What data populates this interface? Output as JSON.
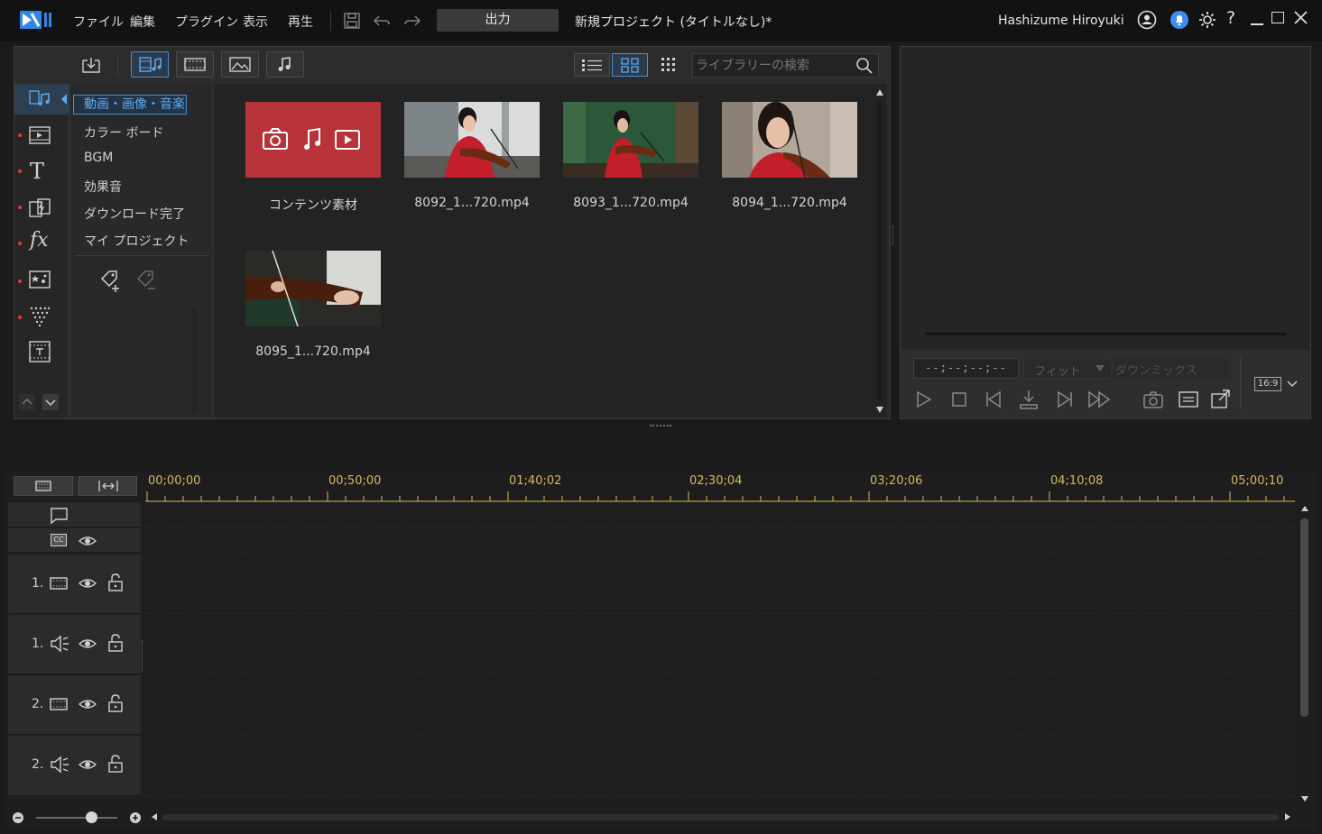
{
  "menu": [
    "ファイル",
    "編集",
    "プラグイン",
    "表示",
    "再生"
  ],
  "output_button": "出力",
  "project_title": "新規プロジェクト (タイトルなし)*",
  "user_name": "Hashizume Hiroyuki",
  "library": {
    "search_placeholder": "ライブラリーの検索",
    "categories": [
      "動画・画像・音楽",
      "カラー ボード",
      "BGM",
      "効果音",
      "ダウンロード完了",
      "マイ プロジェクト"
    ],
    "items": [
      {
        "label": "コンテンツ素材",
        "type": "content-pack"
      },
      {
        "label": "8092_1...720.mp4",
        "type": "video"
      },
      {
        "label": "8093_1...720.mp4",
        "type": "video"
      },
      {
        "label": "8094_1...720.mp4",
        "type": "video"
      },
      {
        "label": "8095_1...720.mp4",
        "type": "video"
      }
    ]
  },
  "preview": {
    "timecode": "--;--;--;--",
    "fit": "フィット",
    "dropdown_label": "ダウンミックス",
    "aspect": "16:9"
  },
  "timeline": {
    "ticks": [
      "00;00;00",
      "00;50;00",
      "01;40;02",
      "02;30;04",
      "03;20;06",
      "04;10;08",
      "05;00;10"
    ],
    "tracks": [
      {
        "num": "1.",
        "kind": "video"
      },
      {
        "num": "1.",
        "kind": "audio"
      },
      {
        "num": "2.",
        "kind": "video"
      },
      {
        "num": "2.",
        "kind": "audio"
      }
    ]
  },
  "colors": {
    "accent": "#4a8bd6",
    "ruler": "#d8b85a",
    "content_pack": "#b8323a"
  }
}
